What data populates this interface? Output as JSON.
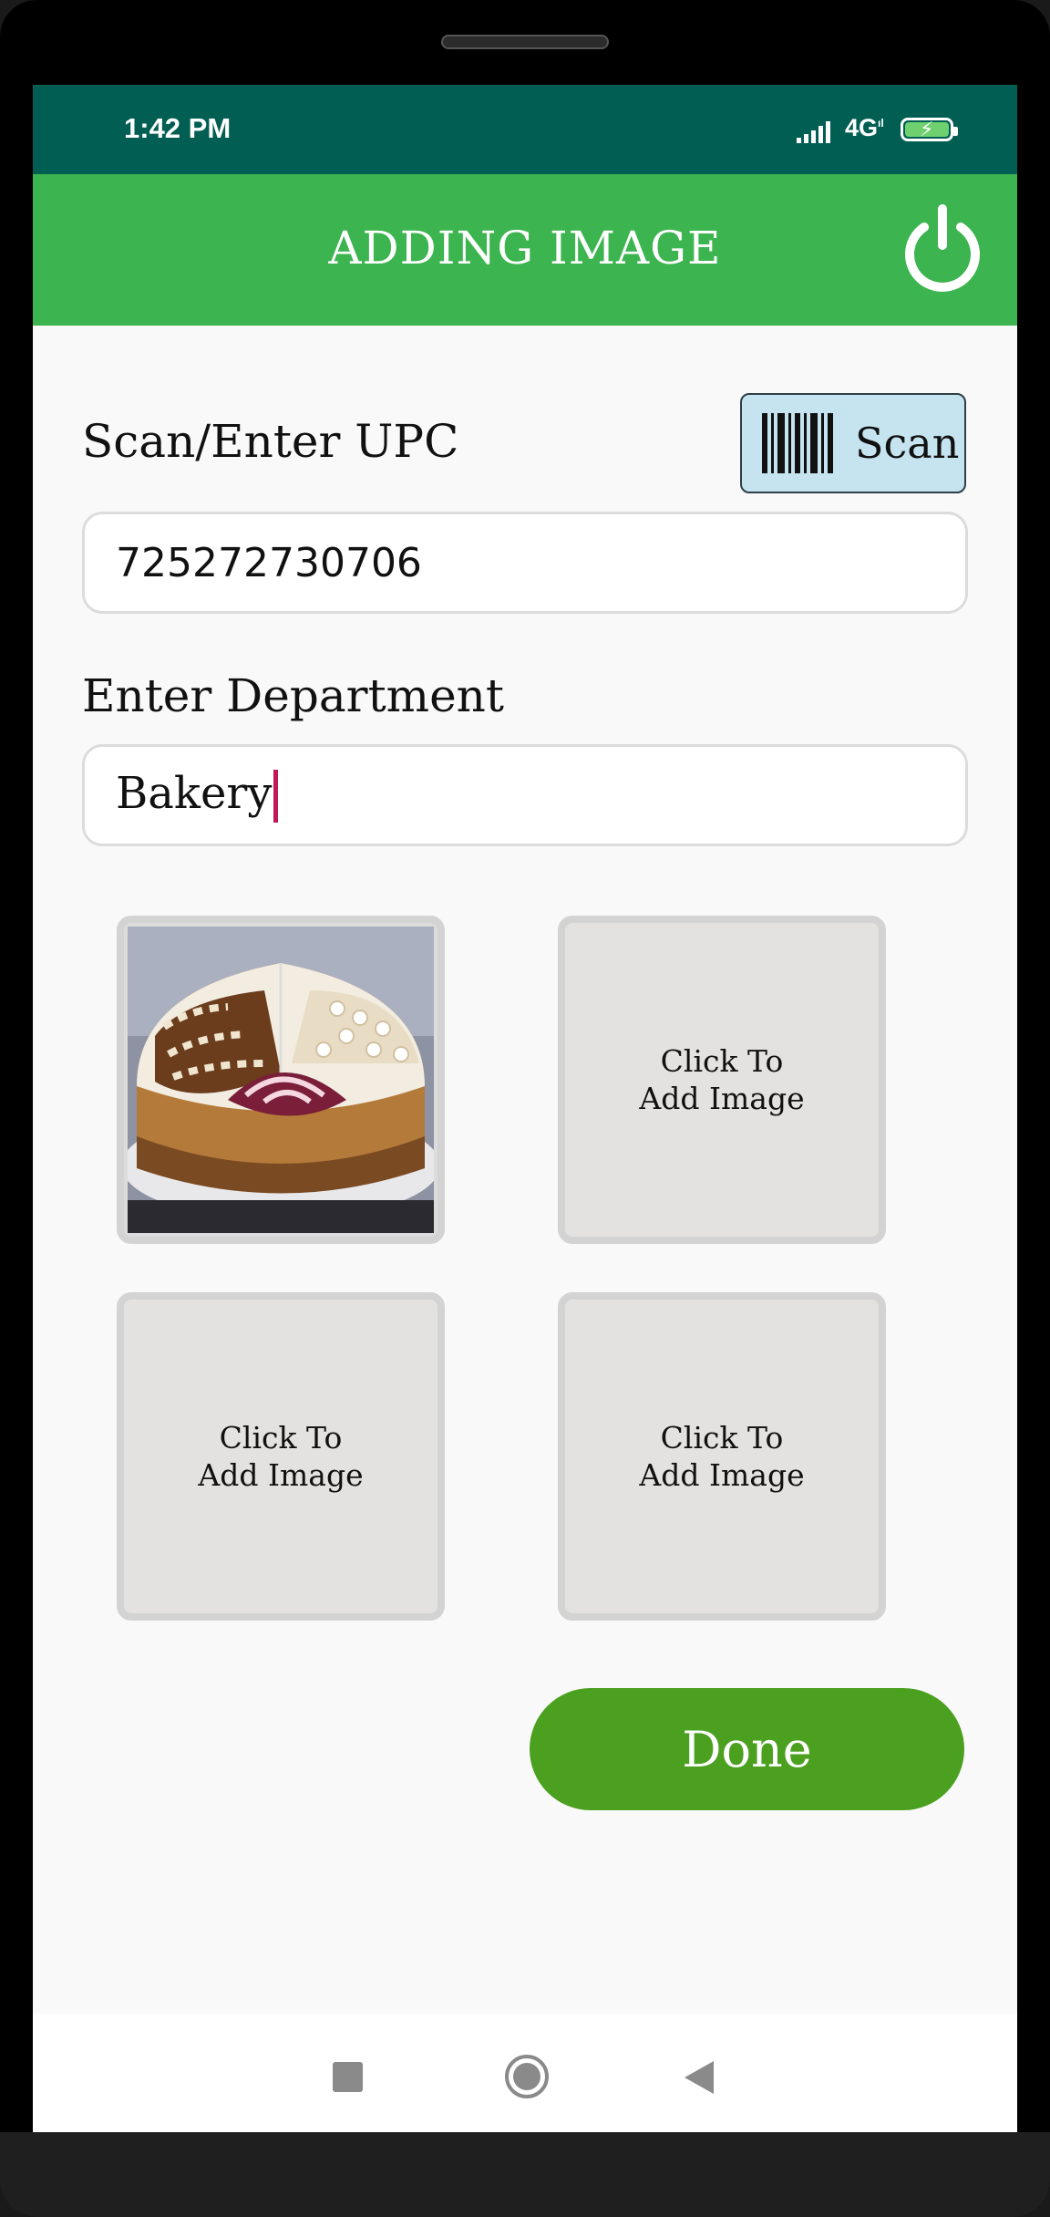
{
  "status_bar": {
    "time": "1:42 PM",
    "network": "4G",
    "network_sub": "ıl"
  },
  "app_bar": {
    "title": "ADDING IMAGE",
    "power_icon": "power-icon"
  },
  "upc": {
    "label": "Scan/Enter UPC",
    "value": "725272730706",
    "scan_button": "Scan"
  },
  "department": {
    "label": "Enter Department",
    "value": "Bakery"
  },
  "images": {
    "tile_1": {
      "alt": "cheesecake-photo"
    },
    "tile_2": {
      "text": "Click To Add Image"
    },
    "tile_3": {
      "text": "Click To Add Image"
    },
    "tile_4": {
      "text": "Click To Add Image"
    }
  },
  "done_button": "Done",
  "colors": {
    "status_bar": "#005e53",
    "app_bar": "#3cb44f",
    "done": "#4ca020",
    "scan_button": "#c6e3f0",
    "caret": "#c2185b"
  }
}
